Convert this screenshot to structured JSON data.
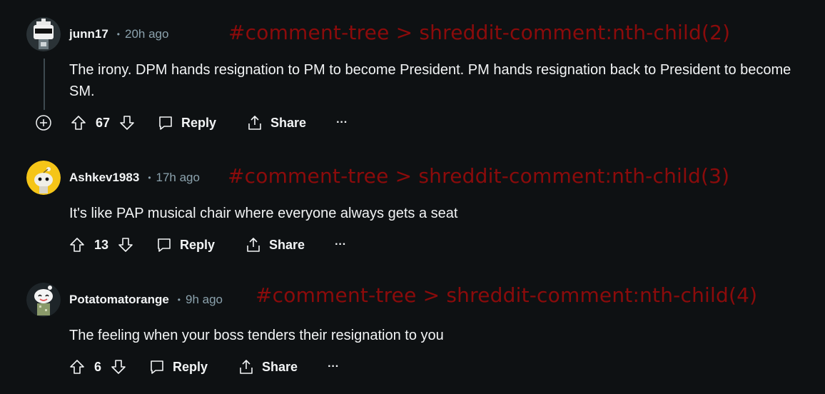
{
  "comments": [
    {
      "author": "junn17",
      "time": "20h ago",
      "selector": "#comment-tree > shreddit-comment:nth-child(2)",
      "body": "The irony. DPM hands resignation to PM to become President. PM hands resignation back to President to become SM.",
      "score": "67",
      "reply_label": "Reply",
      "share_label": "Share",
      "more_label": "···",
      "avatar": "robot-sunglasses-avatar"
    },
    {
      "author": "Ashkev1983",
      "time": "17h ago",
      "selector": "#comment-tree > shreddit-comment:nth-child(3)",
      "body": "It's like PAP musical chair where everyone always gets a seat",
      "score": "13",
      "reply_label": "Reply",
      "share_label": "Share",
      "more_label": "···",
      "avatar": "yellow-snoo-avatar"
    },
    {
      "author": "Potatomatorange",
      "time": "9h ago",
      "selector": "#comment-tree > shreddit-comment:nth-child(4)",
      "body": "The feeling when your boss tenders their resignation to you",
      "score": "6",
      "reply_label": "Reply",
      "share_label": "Share",
      "more_label": "···",
      "avatar": "smiling-snoo-avatar"
    }
  ],
  "colors": {
    "background": "#0e1113",
    "text": "#f2f4f5",
    "muted": "#8ba2ad",
    "selector_overlay": "#8b0b0b"
  }
}
